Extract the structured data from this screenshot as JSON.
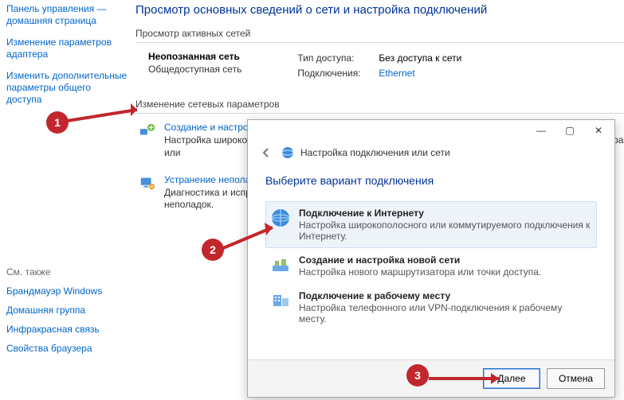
{
  "sidebar": {
    "items": [
      "Панель управления — домашняя страница",
      "Изменение параметров адаптера",
      "Изменить дополнительные параметры общего доступа"
    ],
    "seealso_label": "См. также",
    "seealso": [
      "Брандмауэр Windows",
      "Домашняя группа",
      "Инфракрасная связь",
      "Свойства браузера"
    ]
  },
  "main": {
    "page_title": "Просмотр основных сведений о сети и настройка подключений",
    "active_heading": "Просмотр активных сетей",
    "network": {
      "name": "Неопознанная сеть",
      "type": "Общедоступная сеть",
      "access_label": "Тип доступа:",
      "access_value": "Без доступа к сети",
      "conn_label": "Подключения:",
      "conn_value": "Ethernet"
    },
    "change_heading": "Изменение сетевых параметров",
    "tasks": [
      {
        "title": "Создание и настройка нового подключения или сети",
        "desc": "Настройка широкополосного, коммутируемого или VPN-подключения либо настройка маршрутизатора или"
      },
      {
        "title": "Устранение неполад",
        "desc": "Диагностика и испра\nнеполадок."
      }
    ]
  },
  "wizard": {
    "title": "Настройка подключения или сети",
    "heading": "Выберите вариант подключения",
    "options": [
      {
        "title": "Подключение к Интернету",
        "desc": "Настройка широкополосного или коммутируемого подключения к Интернету."
      },
      {
        "title": "Создание и настройка новой сети",
        "desc": "Настройка нового маршрутизатора или точки доступа."
      },
      {
        "title": "Подключение к рабочему месту",
        "desc": "Настройка телефонного или VPN-подключения к рабочему месту."
      }
    ],
    "next_label": "Далее",
    "cancel_label": "Отмена"
  },
  "annot": {
    "b1": "1",
    "b2": "2",
    "b3": "3"
  }
}
